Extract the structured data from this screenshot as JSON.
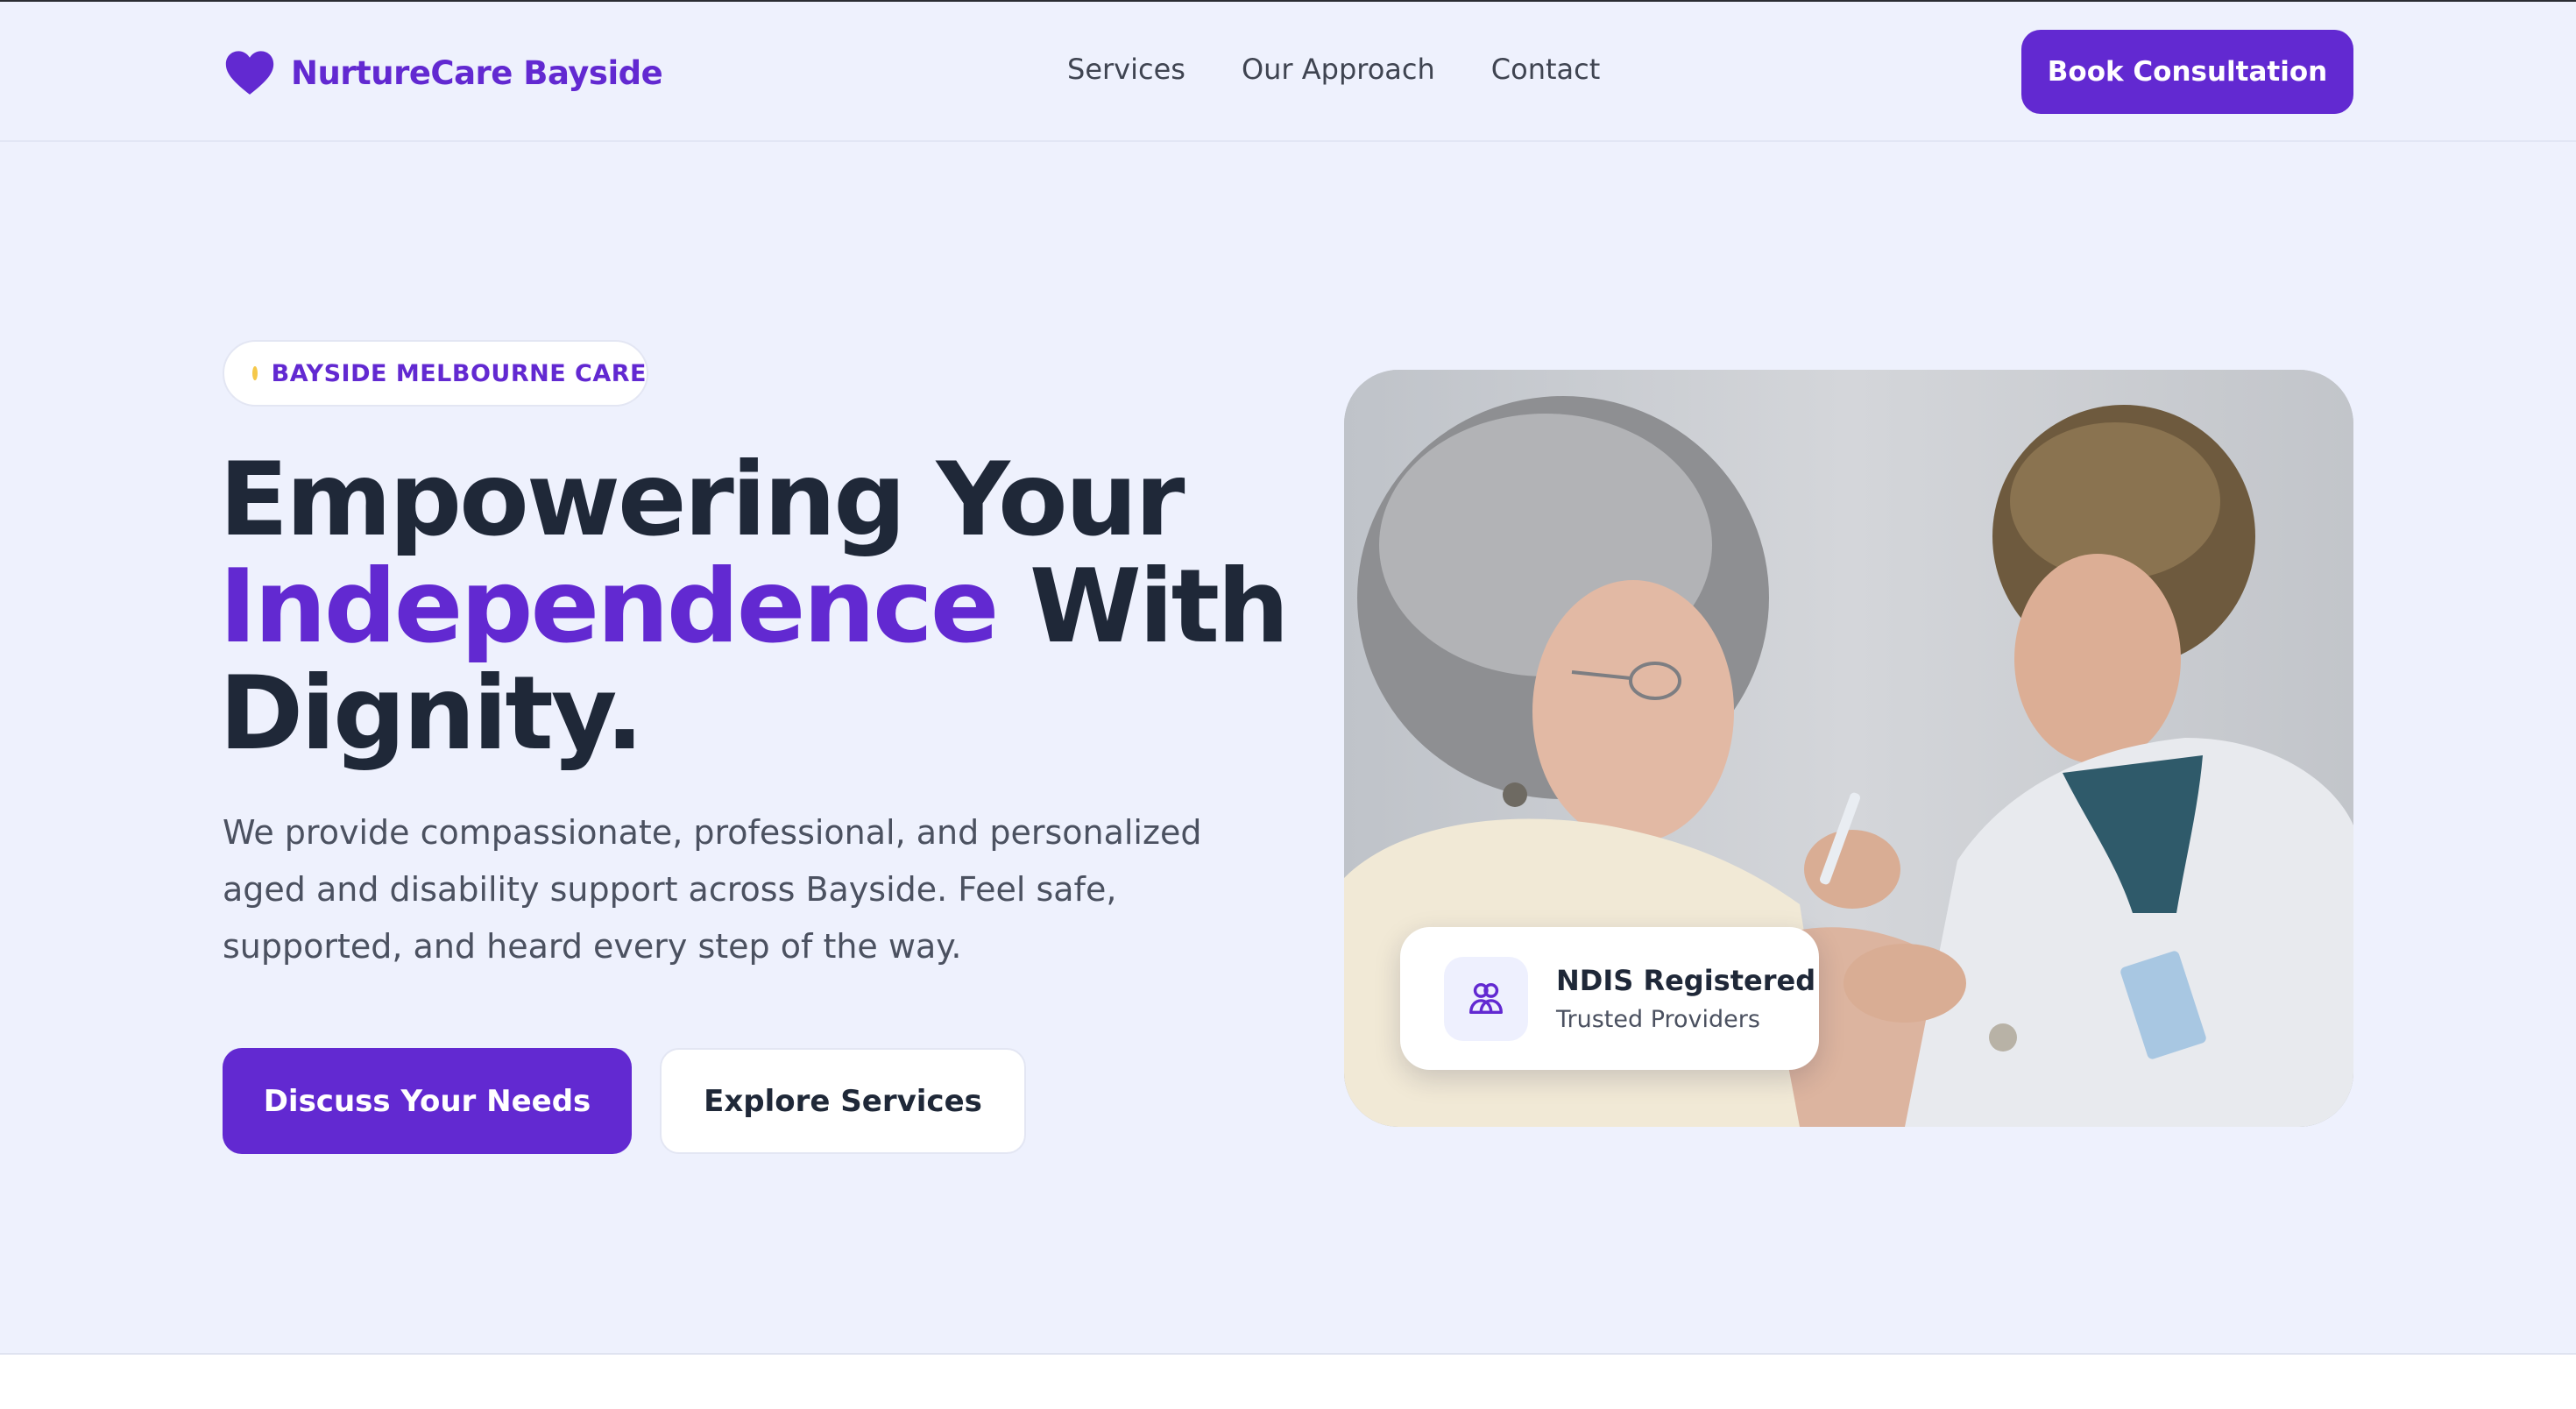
{
  "brand": {
    "name": "NurtureCare Bayside",
    "logo_icon": "heart-icon",
    "accent_color": "#6229d1",
    "badge_dot_color": "#f5c84a"
  },
  "nav": {
    "items": [
      {
        "label": "Services"
      },
      {
        "label": "Our Approach"
      },
      {
        "label": "Contact"
      }
    ],
    "cta_label": "Book Consultation"
  },
  "hero": {
    "badge": "BAYSIDE MELBOURNE CARE",
    "headline": {
      "line1": "Empowering Your",
      "accent": "Independence",
      "line2_rest": "With",
      "line3": "Dignity."
    },
    "lead": "We provide compassionate, professional, and personalized aged and disability support across Bayside. Feel safe, supported, and heard every step of the way.",
    "primary_button": "Discuss Your Needs",
    "secondary_button": "Explore Services",
    "card": {
      "icon": "users-icon",
      "title": "NDIS Registered",
      "subtitle": "Trusted Providers"
    }
  }
}
